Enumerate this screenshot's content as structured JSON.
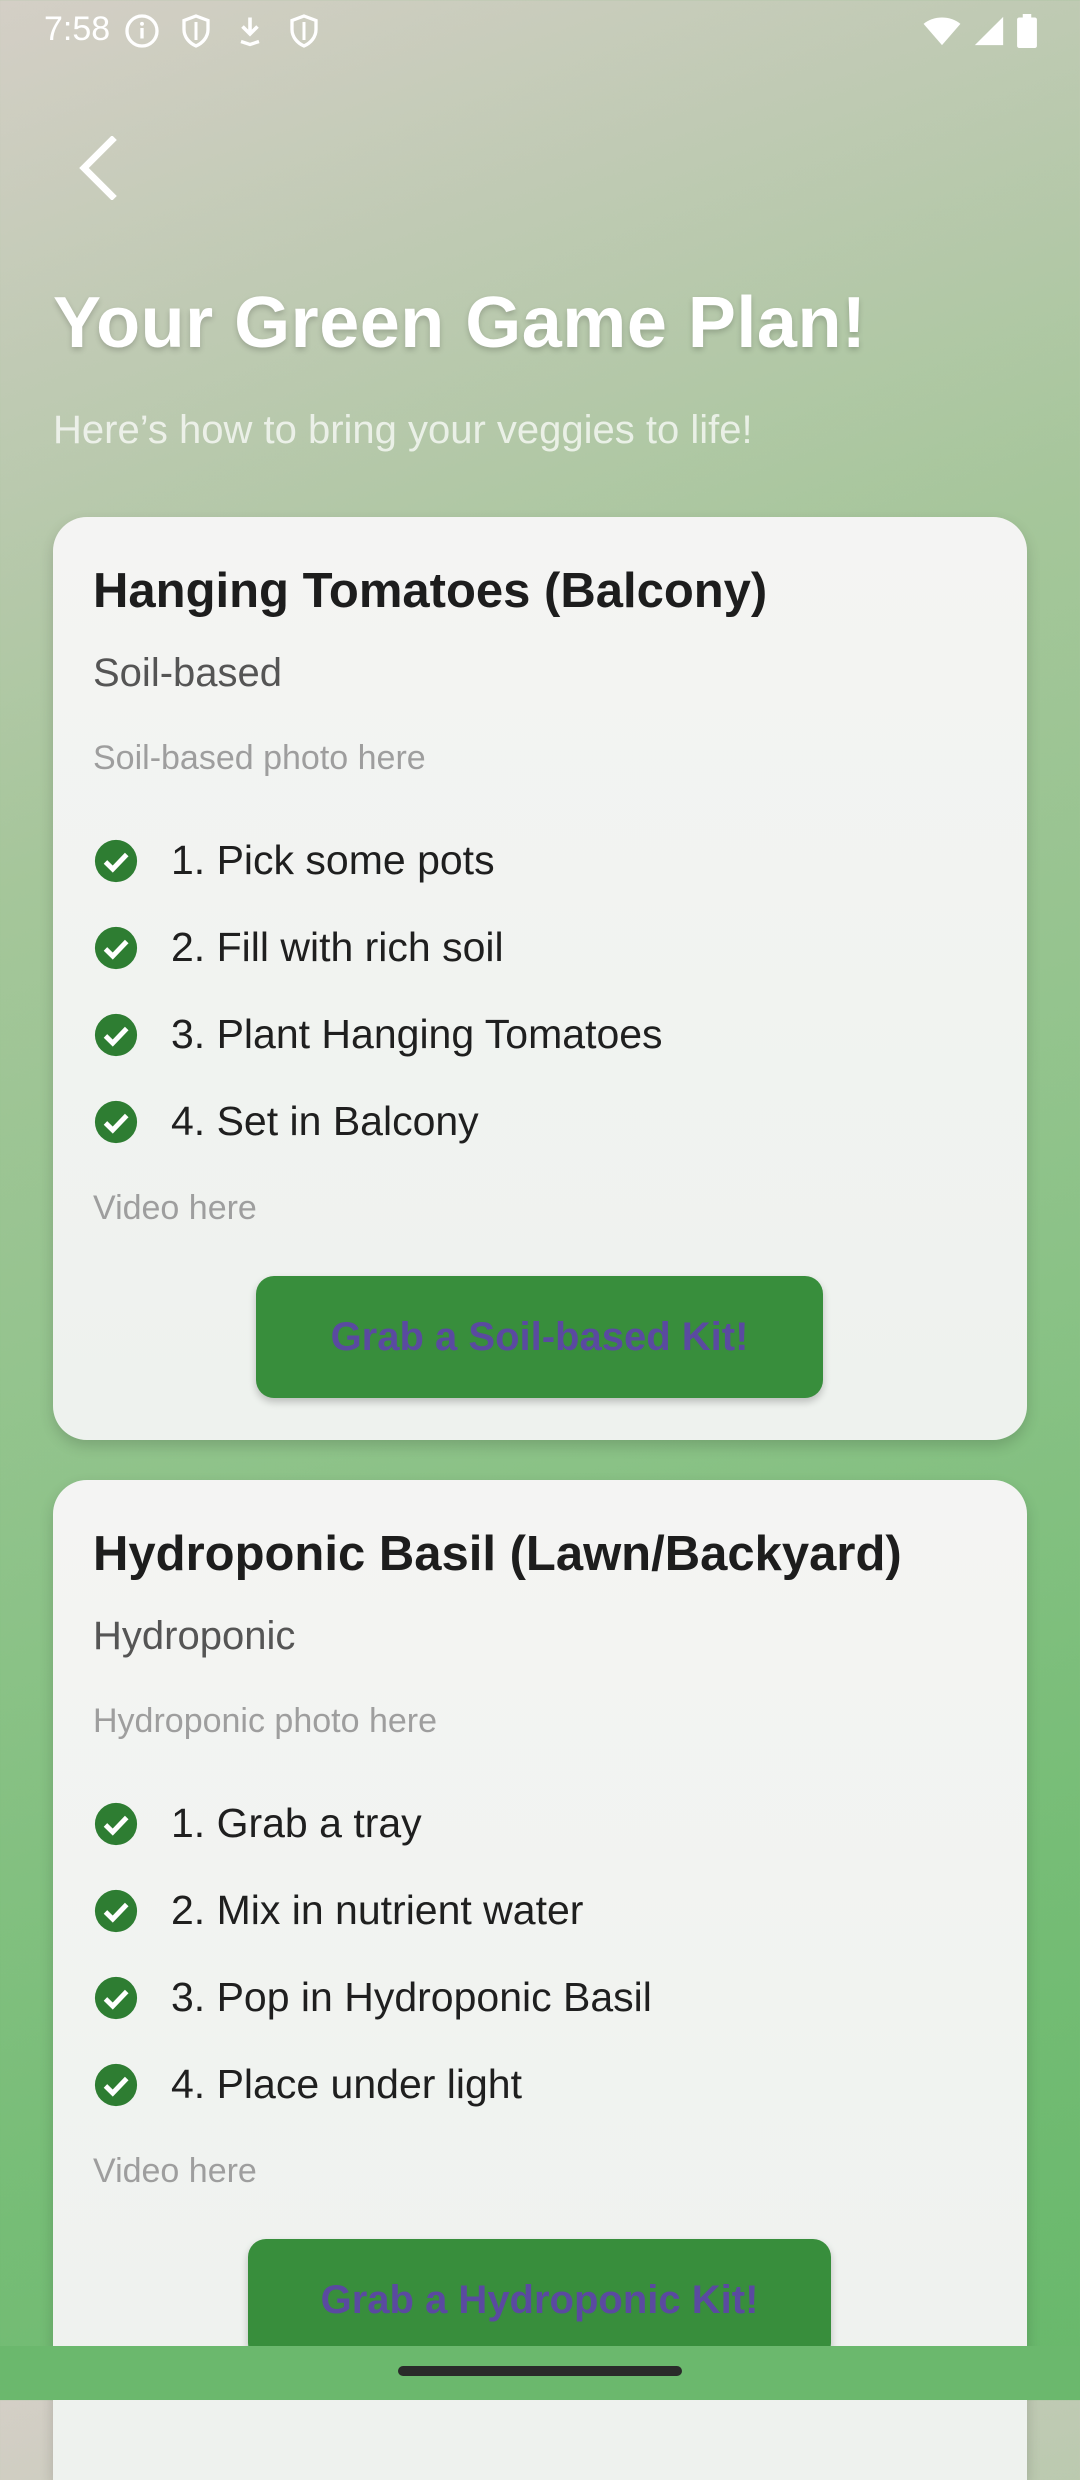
{
  "status_bar": {
    "time": "7:58",
    "left_icons": [
      "info-icon",
      "shield-icon",
      "download-icon",
      "shield-icon"
    ],
    "right_icons": [
      "wifi-icon",
      "signal-icon",
      "battery-icon"
    ]
  },
  "header": {
    "back_icon": "back-chevron-icon",
    "title": "Your Green Game Plan!",
    "subtitle": "Here’s how to bring your veggies to life!"
  },
  "cards": [
    {
      "title": "Hanging Tomatoes (Balcony)",
      "method": "Soil-based",
      "photo_placeholder": "Soil-based photo here",
      "steps": [
        "1. Pick some pots",
        "2. Fill with rich soil",
        "3. Plant Hanging Tomatoes",
        "4. Set in Balcony"
      ],
      "video_placeholder": "Video here",
      "button_label": "Grab a Soil-based Kit!"
    },
    {
      "title": "Hydroponic Basil (Lawn/Backyard)",
      "method": "Hydroponic",
      "photo_placeholder": "Hydroponic photo here",
      "steps": [
        "1. Grab a tray",
        "2. Mix in nutrient water",
        "3. Pop in Hydroponic Basil",
        "4. Place under light"
      ],
      "video_placeholder": "Video here",
      "button_label": "Grab a Hydroponic Kit!"
    }
  ],
  "colors": {
    "accent_green": "#388e3c",
    "button_text": "#5a4aa0",
    "check_green": "#2e7d32"
  }
}
